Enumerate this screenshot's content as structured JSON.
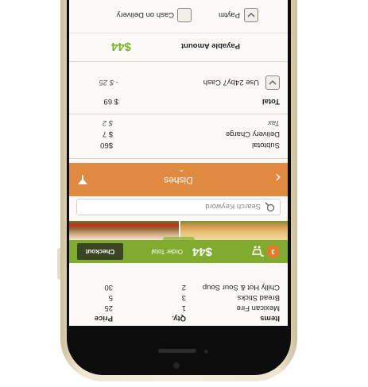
{
  "payment": {
    "cash_on_delivery": "Cash on Delivery",
    "paytm": "Paytm"
  },
  "payable": {
    "label": "Payable Amount",
    "amount": "$44"
  },
  "total": {
    "label": "Total",
    "value": "$ 69",
    "cash_label": "Use 24by7 Cash",
    "cash_value": "- $ 25"
  },
  "summary": {
    "tax_label": "Tax",
    "tax_value": "$ 2",
    "delivery_label": "Delivery Charge",
    "delivery_value": "$ 7",
    "subtotal_label": "Subtotal",
    "subtotal_value": "$60"
  },
  "items_table": {
    "headers": [
      "Items",
      "Qty.",
      "Price"
    ],
    "rows": [
      {
        "item": "Mexican Fire",
        "qty": "1",
        "price": "25"
      },
      {
        "item": "Bread Sticks",
        "qty": "3",
        "price": "5"
      },
      {
        "item": "Chilly Hot & Sour Soup",
        "qty": "2",
        "price": "30"
      }
    ]
  },
  "checkout_bar": {
    "cart_count": "3",
    "order_total_label": "Order Total",
    "order_total": "$44",
    "checkout_label": "Checkout"
  },
  "search": {
    "placeholder": "Search Keyword"
  },
  "nav": {
    "title": "Dishes"
  },
  "colors": {
    "green": "#7fac2e",
    "orange": "#e08941",
    "dark_button": "#3b4724"
  }
}
